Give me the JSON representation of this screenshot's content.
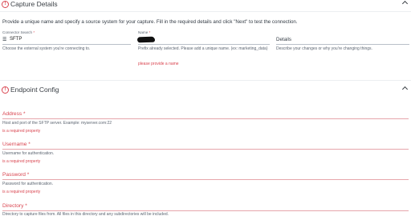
{
  "capture_details": {
    "section_title": "Capture Details",
    "info_icon": "!",
    "intro": "Provide a unique name and specify a source system for your capture. Fill in the required details and click \"Next\" to test the connection.",
    "connector": {
      "label": "Connector Search",
      "required_mark": "*",
      "value": "SFTP",
      "help": "Choose the external system you're connecting to."
    },
    "name": {
      "label": "Name",
      "required_mark": "*",
      "help": "Prefix already selected. Please add a unique name. (ex: marketing_data)",
      "error": "please provide a name"
    },
    "details": {
      "label": "Details",
      "help": "Describe your changes or why you're changing things."
    }
  },
  "endpoint_config": {
    "section_title": "Endpoint Config",
    "info_icon": "!",
    "fields": [
      {
        "label": "Address",
        "required_mark": "*",
        "help": "Host and port of the SFTP server. Example: myserver.com:22",
        "error": "is a required property"
      },
      {
        "label": "Username",
        "required_mark": "*",
        "help": "Username for authentication.",
        "error": "is a required property"
      },
      {
        "label": "Password",
        "required_mark": "*",
        "help": "Password for authentication.",
        "error": "is a required property"
      },
      {
        "label": "Directory",
        "required_mark": "*",
        "help": "Directory to capture files from. All files in this directory and any subdirectories will be included.",
        "error": ""
      }
    ]
  },
  "colors": {
    "error": "#d9444f",
    "text": "#1f2933",
    "muted": "#5d6672"
  }
}
